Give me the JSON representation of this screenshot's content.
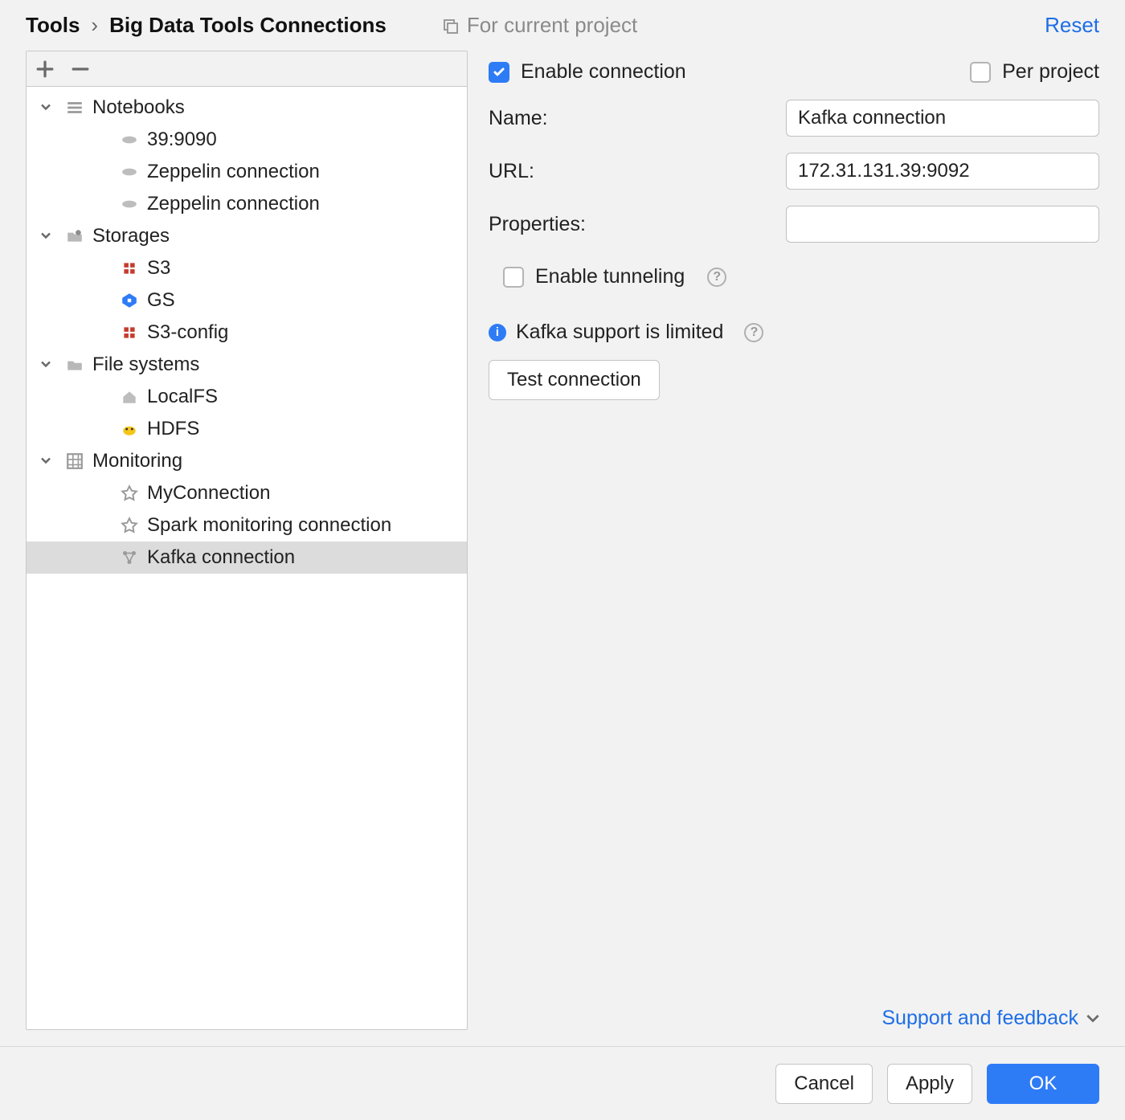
{
  "breadcrumb": {
    "root": "Tools",
    "sep": "›",
    "page": "Big Data Tools Connections"
  },
  "scope_label": "For current project",
  "reset_label": "Reset",
  "tree": {
    "groups": [
      {
        "id": "notebooks",
        "label": "Notebooks",
        "icon": "stack-icon",
        "items": [
          {
            "id": "conn-39-9090",
            "label": "39:9090",
            "icon": "zeppelin-icon"
          },
          {
            "id": "zeppelin-1",
            "label": "Zeppelin connection",
            "icon": "zeppelin-icon"
          },
          {
            "id": "zeppelin-2",
            "label": "Zeppelin connection",
            "icon": "zeppelin-icon"
          }
        ]
      },
      {
        "id": "storages",
        "label": "Storages",
        "icon": "folder-gear-icon",
        "items": [
          {
            "id": "s3",
            "label": "S3",
            "icon": "s3-icon"
          },
          {
            "id": "gs",
            "label": "GS",
            "icon": "gs-icon"
          },
          {
            "id": "s3config",
            "label": "S3-config",
            "icon": "s3-icon"
          }
        ]
      },
      {
        "id": "filesystems",
        "label": "File systems",
        "icon": "folder-icon",
        "items": [
          {
            "id": "localfs",
            "label": "LocalFS",
            "icon": "home-icon"
          },
          {
            "id": "hdfs",
            "label": "HDFS",
            "icon": "hadoop-icon"
          }
        ]
      },
      {
        "id": "monitoring",
        "label": "Monitoring",
        "icon": "grid-icon",
        "items": [
          {
            "id": "myconn",
            "label": "MyConnection",
            "icon": "star-icon"
          },
          {
            "id": "spark-mon",
            "label": "Spark monitoring connection",
            "icon": "star-icon"
          },
          {
            "id": "kafka",
            "label": "Kafka connection",
            "icon": "nodes-icon",
            "selected": true
          }
        ]
      }
    ]
  },
  "form": {
    "enable_connection": {
      "label": "Enable connection",
      "checked": true
    },
    "per_project": {
      "label": "Per project",
      "checked": false
    },
    "name": {
      "label": "Name:",
      "value": "Kafka connection"
    },
    "url": {
      "label": "URL:",
      "value": "172.31.131.39:9092"
    },
    "properties": {
      "label": "Properties:",
      "value": ""
    },
    "enable_tunneling": {
      "label": "Enable tunneling",
      "checked": false
    },
    "support_notice": "Kafka support is limited",
    "test_connection": "Test connection",
    "support_link": "Support and feedback"
  },
  "footer": {
    "cancel": "Cancel",
    "apply": "Apply",
    "ok": "OK"
  }
}
